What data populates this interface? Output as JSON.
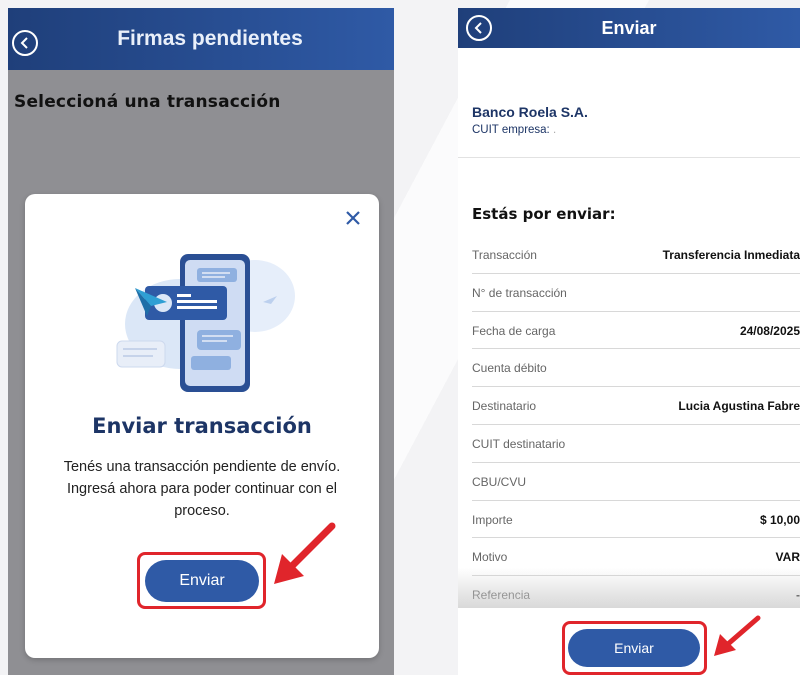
{
  "left_screen": {
    "header": {
      "title": "Firmas pendientes"
    },
    "subtitle": "Seleccioná una transacción",
    "modal": {
      "title": "Enviar transacción",
      "text": "Tenés una transacción pendiente de envío. Ingresá ahora para poder continuar con el proceso.",
      "button_label": "Enviar"
    }
  },
  "right_screen": {
    "header": {
      "title": "Enviar"
    },
    "company": {
      "name": "Banco Roela S.A.",
      "cuit_label": "CUIT empresa:",
      "cuit_value": "."
    },
    "section_title": "Estás por enviar:",
    "details": [
      {
        "label": "Transacción",
        "value": "Transferencia Inmediata"
      },
      {
        "label": "N° de transacción",
        "value": ""
      },
      {
        "label": "Fecha de carga",
        "value": "24/08/2025"
      },
      {
        "label": "Cuenta débito",
        "value": ""
      },
      {
        "label": "Destinatario",
        "value": "Lucia Agustina Fabre"
      },
      {
        "label": "CUIT destinatario",
        "value": ""
      },
      {
        "label": "CBU/CVU",
        "value": ""
      },
      {
        "label": "Importe",
        "value": "$ 10,00"
      },
      {
        "label": "Motivo",
        "value": "VAR"
      },
      {
        "label": "Referencia",
        "value": "-"
      }
    ],
    "button_label": "Enviar"
  },
  "colors": {
    "header_dark": "#1f3f7a",
    "primary_button": "#2f5aa6",
    "annotation_red": "#e0252b",
    "title_navy": "#1d3566"
  },
  "icons": {
    "back": "chevron-left-circle-icon",
    "close": "close-icon",
    "annotation": "red-arrow-icon"
  }
}
